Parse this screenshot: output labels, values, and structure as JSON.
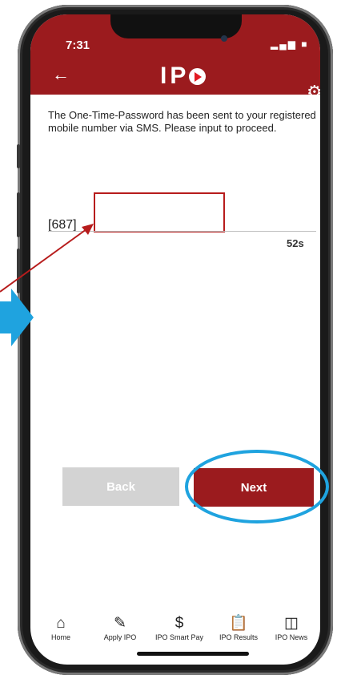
{
  "status_bar": {
    "time": "7:31",
    "icons": "▂▄▆ ■"
  },
  "header": {
    "logo_text": "IP",
    "back_icon": "back-arrow-icon",
    "settings_icon": "gear-icon"
  },
  "otp": {
    "message": "The One-Time-Password has been sent to your registered mobile number via SMS. Please input to proceed.",
    "prefix": "[687]",
    "value": "",
    "countdown": "52s"
  },
  "buttons": {
    "back_label": "Back",
    "next_label": "Next"
  },
  "tabs": [
    {
      "label": "Home",
      "icon": "home-icon"
    },
    {
      "label": "Apply IPO",
      "icon": "pencil-icon"
    },
    {
      "label": "IPO Smart Pay",
      "icon": "dollar-icon"
    },
    {
      "label": "IPO Results",
      "icon": "clipboard-icon"
    },
    {
      "label": "IPO News",
      "icon": "newspaper-icon"
    }
  ],
  "colors": {
    "brand": "#9b1b1e",
    "annotation_red": "#b71c1c",
    "annotation_blue": "#1fa3df",
    "disabled": "#d3d3d3"
  }
}
